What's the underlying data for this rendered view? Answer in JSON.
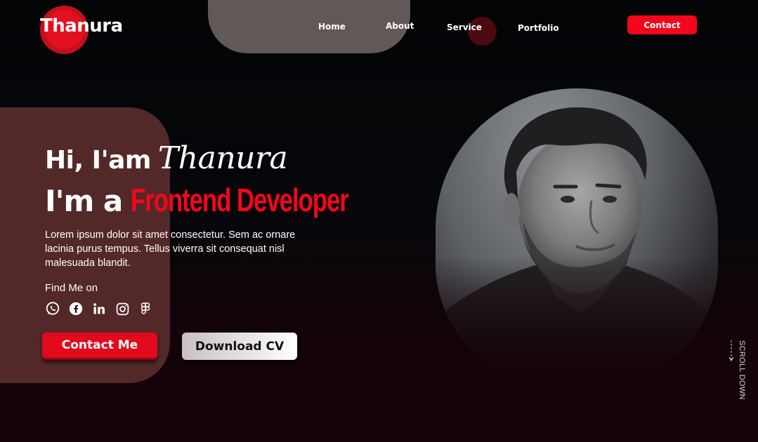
{
  "brand": {
    "logo_text": "Thanura",
    "accent": "#f2071c"
  },
  "nav": {
    "items": [
      {
        "label": "Home"
      },
      {
        "label": "About"
      },
      {
        "label": "Service"
      },
      {
        "label": "Portfolio"
      }
    ],
    "contact_label": "Contact"
  },
  "hero": {
    "greeting": "Hi, I'am",
    "name": "Thanura",
    "role_prefix": "I'm a",
    "role": "Frontend Developer",
    "description": "Lorem ipsum dolor sit amet consectetur. Sem ac ornare lacinia purus tempus. Tellus viverra sit consequat nisl malesuada blandit.",
    "find_label": "Find Me on",
    "socials": [
      "whatsapp-icon",
      "facebook-icon",
      "linkedin-icon",
      "instagram-icon",
      "figma-icon"
    ],
    "primary_button": "Contact Me",
    "secondary_button": "Download CV"
  },
  "scroll": {
    "label": "SCROLL DOWN"
  }
}
